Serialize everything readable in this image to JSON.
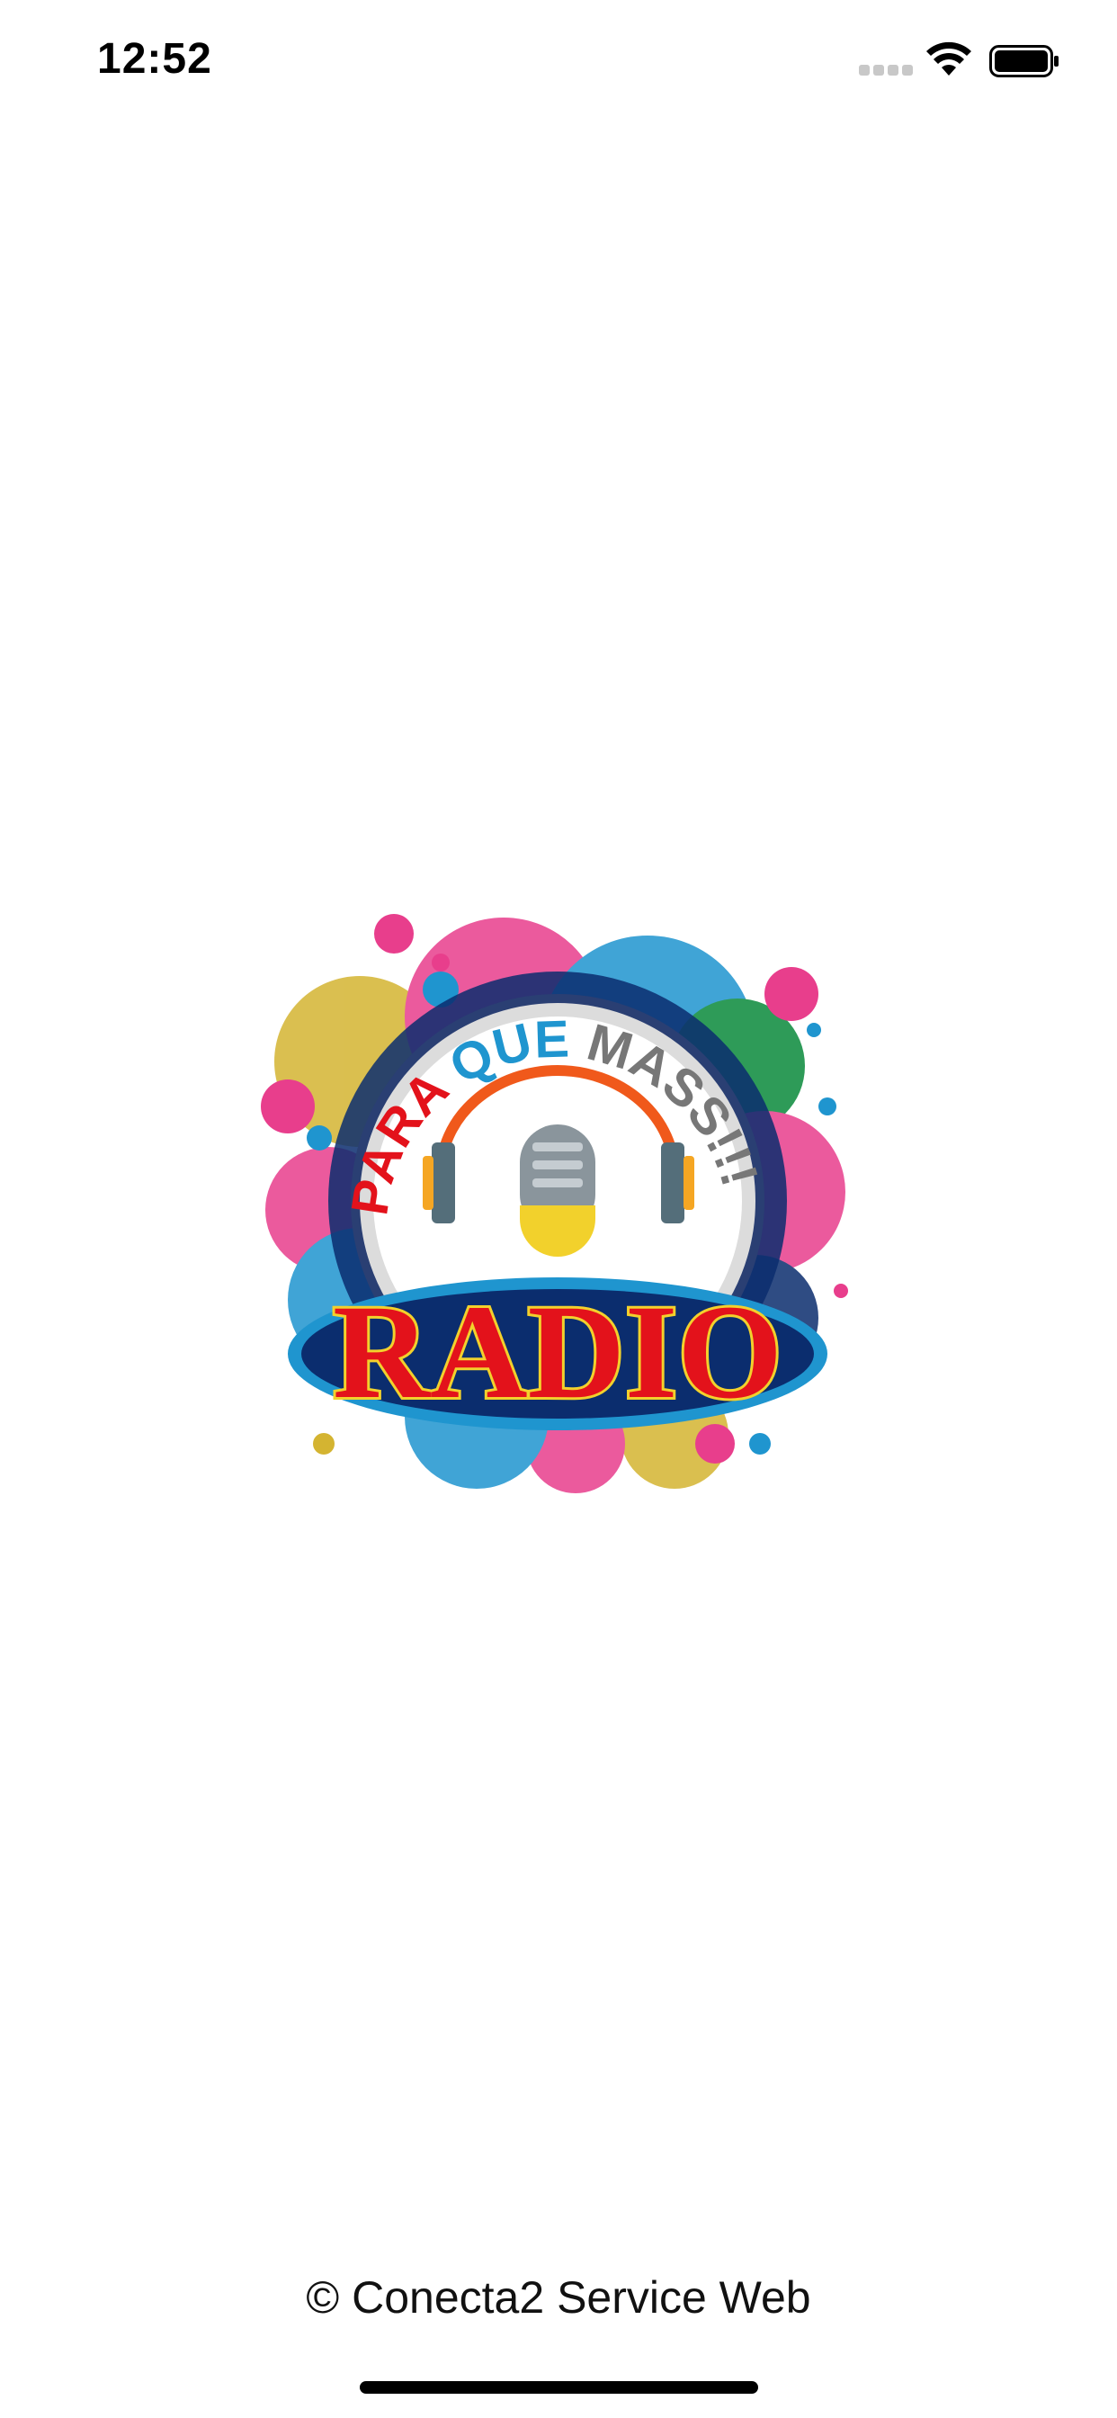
{
  "status_bar": {
    "time": "12:52",
    "icons": [
      "cellular-signal-icon",
      "wifi-icon",
      "battery-icon"
    ]
  },
  "logo": {
    "top_text": "PARA QUE MASS!!!",
    "main_text": "RADIO",
    "icon": "microphone-headphones-icon",
    "colors": {
      "pink": "#e83e8c",
      "yellow": "#d4b431",
      "blue": "#1f95cf",
      "red": "#e3121b",
      "dark_blue": "#0b2d6e"
    }
  },
  "footer": {
    "copyright": "© Conecta2 Service Web"
  }
}
